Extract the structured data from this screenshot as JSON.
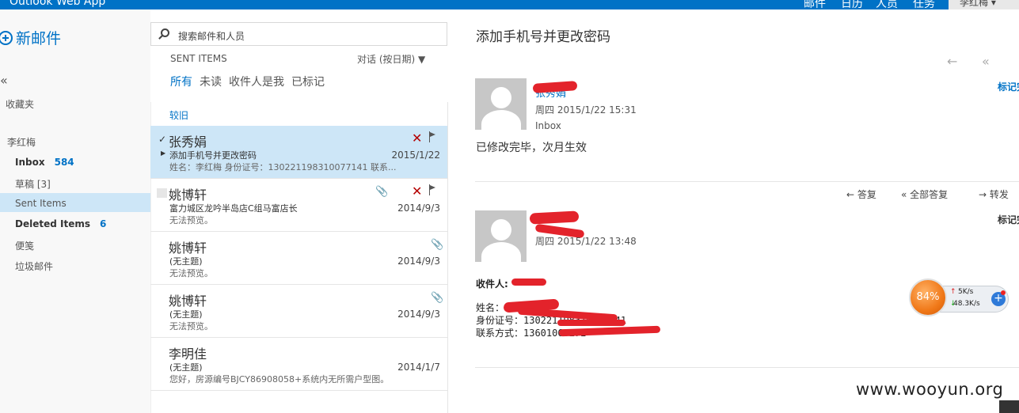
{
  "topbar": {
    "app_title": "Outlook Web App",
    "nav": [
      "邮件",
      "日历",
      "人员",
      "任务"
    ],
    "user": "李红梅 ▾"
  },
  "left": {
    "new_mail": "新邮件",
    "collapse": "«",
    "favorites": "收藏夹",
    "account": "李红梅",
    "folders": [
      {
        "label": "Inbox",
        "count": "584"
      },
      {
        "label": "草稿 [3]"
      },
      {
        "label": "Sent Items"
      },
      {
        "label": "Deleted Items",
        "count": "6"
      },
      {
        "label": "便笺"
      },
      {
        "label": "垃圾邮件"
      }
    ]
  },
  "list": {
    "search_placeholder": "搜索邮件和人员",
    "folder_title": "SENT ITEMS",
    "sort": "对话 (按日期) ▼",
    "filters": [
      "所有",
      "未读",
      "收件人是我",
      "已标记"
    ],
    "group_label": "较旧",
    "messages": [
      {
        "from": "张秀娟",
        "subject": "添加手机号并更改密码",
        "preview": "姓名：李红梅 身份证号：130221198310077141 联系...",
        "date": "2015/1/22"
      },
      {
        "from": "姚博轩",
        "subject": "富力城区龙吟半岛店C组马富店长",
        "preview": "无法预览。",
        "date": "2014/9/3"
      },
      {
        "from": "姚博轩",
        "subject": "(无主题)",
        "preview": "无法预览。",
        "date": "2014/9/3"
      },
      {
        "from": "姚博轩",
        "subject": "(无主题)",
        "preview": "无法预览。",
        "date": "2014/9/3"
      },
      {
        "from": "李明佳",
        "subject": "(无主题)",
        "preview": "您好，房源编号BJCY86908058+系统内无所需户型图。",
        "date": "2014/1/7"
      }
    ]
  },
  "reading": {
    "title": "添加手机号并更改密码",
    "tag_label": "标记完",
    "msg1": {
      "sender": "张秀娟",
      "datetime": "周四 2015/1/22 15:31",
      "folder": "Inbox",
      "body": "已修改完毕，次月生效"
    },
    "actions": [
      "答复",
      "全部答复",
      "转发"
    ],
    "msg2": {
      "datetime": "周四 2015/1/22 13:48",
      "to_label": "收件人:",
      "lines": [
        "姓名：",
        "身份证号：130221198310077141",
        "联系方式：13601069272"
      ]
    }
  },
  "widget": {
    "percent": "84%",
    "up": "5K/s",
    "down": "48.3K/s"
  },
  "watermark": "www.wooyun.org",
  "colors": {
    "accent": "#0072c6",
    "selected": "#cde6f7",
    "redact": "#e3232b"
  }
}
